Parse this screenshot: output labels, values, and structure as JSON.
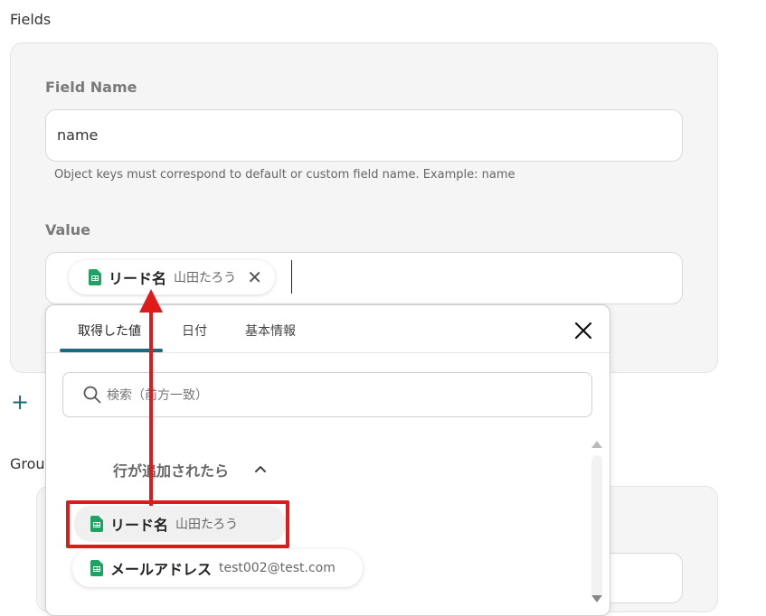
{
  "section_title": "Fields",
  "field_name": {
    "label": "Field Name",
    "value": "name",
    "help": "Object keys must correspond to default or custom field name. Example: name"
  },
  "value_field": {
    "label": "Value",
    "chip": {
      "name": "リード名",
      "value": "山田たろう",
      "remove": "✕"
    }
  },
  "add_field": {
    "icon": "plus-icon",
    "label": ""
  },
  "group_label": "Grou",
  "picker": {
    "tabs": [
      "取得した値",
      "日付",
      "基本情報"
    ],
    "active_tab": 0,
    "search_placeholder": "検索（前方一致）",
    "group": {
      "icon": "google-sheets-icon",
      "label": "行が追加されたら",
      "expanded": true
    },
    "items": [
      {
        "name": "リード名",
        "value": "山田たろう"
      },
      {
        "name": "メールアドレス",
        "value": "test002@test.com"
      }
    ]
  },
  "colors": {
    "accent": "#1a6a80",
    "sheets_green": "#1ea362",
    "annotation_red": "#e01a1a"
  }
}
